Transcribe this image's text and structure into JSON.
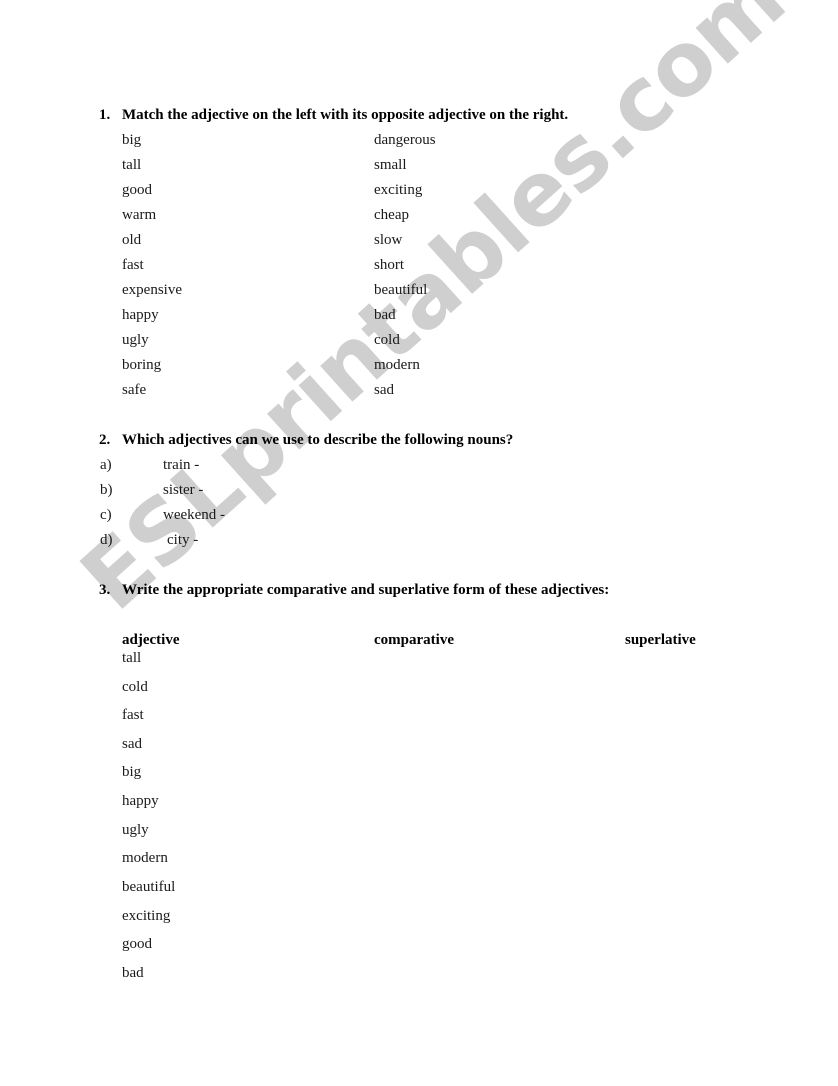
{
  "watermark": {
    "text": "ESLprintables.com",
    "color": "#cfcfcf"
  },
  "sections": {
    "q1": {
      "number": "1.",
      "title": "Match the adjective on the left with its opposite adjective on the right.",
      "left_column": [
        "big",
        "tall",
        "good",
        "warm",
        "old",
        "fast",
        "expensive",
        "happy",
        "ugly",
        "boring",
        "safe"
      ],
      "right_column": [
        "dangerous",
        "small",
        "exciting",
        "cheap",
        "slow",
        "short",
        "beautiful",
        "bad",
        "cold",
        "modern",
        "sad"
      ]
    },
    "q2": {
      "number": "2.",
      "title": "Which adjectives can we use to describe the following nouns?",
      "items": [
        {
          "letter": "a)",
          "text": "train  -"
        },
        {
          "letter": "b)",
          "text": "sister -"
        },
        {
          "letter": "c)",
          "text": "weekend -"
        },
        {
          "letter": "d)",
          "text": "city -"
        }
      ]
    },
    "q3": {
      "number": "3.",
      "title": "Write the appropriate comparative and superlative form of these adjectives:",
      "headers": {
        "adjective": "adjective",
        "comparative": "comparative",
        "superlative": "superlative"
      },
      "adjectives": [
        "tall",
        "cold",
        "fast",
        "sad",
        "big",
        "happy",
        "ugly",
        "modern",
        "beautiful",
        "exciting",
        "good",
        "bad"
      ]
    }
  }
}
